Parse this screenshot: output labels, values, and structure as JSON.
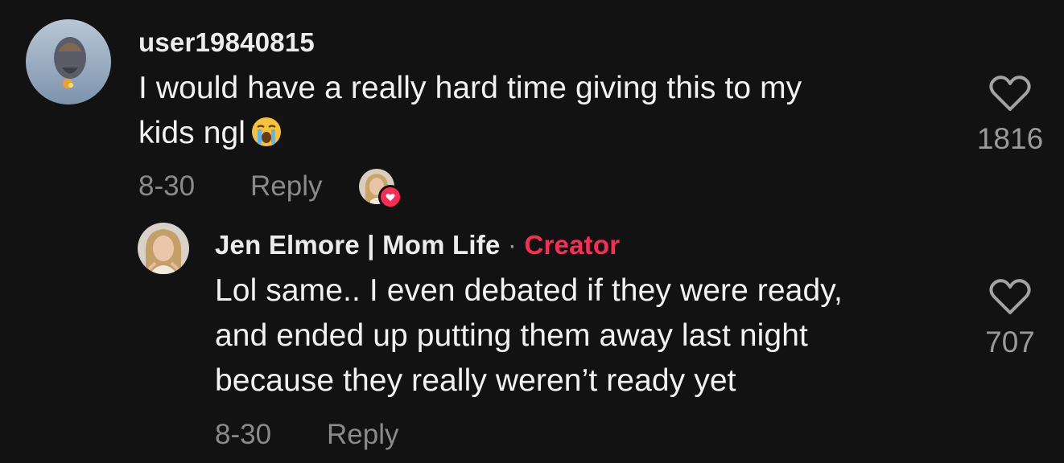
{
  "comments": [
    {
      "username": "user19840815",
      "text_line1": "I would have a really hard time giving this to my",
      "text_line2": "kids ngl",
      "emoji": "loudly-crying-face-emoji",
      "date": "8-30",
      "reply_label": "Reply",
      "like_count": "1816",
      "liked_by_creator": true
    }
  ],
  "reply": {
    "username": "Jen Elmore | Mom Life",
    "separator": "·",
    "creator_label": "Creator",
    "text_line1": "Lol same.. I even debated if they were ready,",
    "text_line2": "and ended up putting them away last night",
    "text_line3": "because they really weren’t ready yet",
    "date": "8-30",
    "reply_label": "Reply",
    "like_count": "707"
  },
  "colors": {
    "background": "#121212",
    "creator_accent": "#fe2c55",
    "muted_text": "#8a8a8a"
  },
  "icons": {
    "like": "heart-outline-icon",
    "creator_liked_badge": "heart-filled-icon"
  }
}
